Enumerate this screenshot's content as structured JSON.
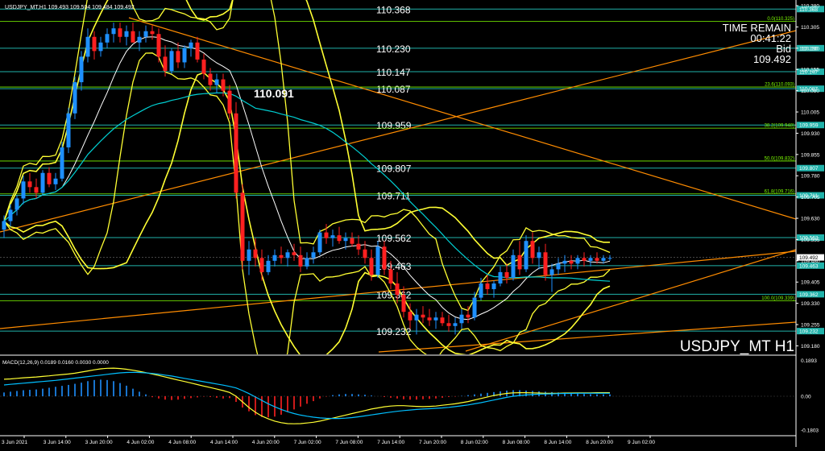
{
  "chart_data": {
    "type": "candlestick",
    "symbol_header": "USDJPY_MT,H1  109.493 109.504 109.484 109.492",
    "watermark": "USDJPY_MT H1",
    "info": {
      "time_remain_label": "TIME REMAIN",
      "time_remain": "00:41:22",
      "bid_label": "Bid",
      "bid": "109.492"
    },
    "price_axis": {
      "ylim": [
        109.15,
        110.4
      ],
      "ticks": [
        "110.380",
        "110.305",
        "110.230",
        "110.155",
        "110.080",
        "110.005",
        "109.930",
        "109.855",
        "109.780",
        "109.705",
        "109.630",
        "109.555",
        "109.480",
        "109.405",
        "109.330",
        "109.255",
        "109.180"
      ]
    },
    "levels": [
      {
        "value": 110.368,
        "label": "110.368",
        "tag": "110.368"
      },
      {
        "value": 110.23,
        "label": "110.230",
        "tag": "110.230"
      },
      {
        "value": 110.147,
        "label": "110.147",
        "tag": "110.147"
      },
      {
        "value": 110.087,
        "label": "110.087",
        "tag": "110.087"
      },
      {
        "value": 109.959,
        "label": "109.959",
        "tag": "109.959"
      },
      {
        "value": 109.807,
        "label": "109.807",
        "tag": "109.807"
      },
      {
        "value": 109.711,
        "label": "109.711",
        "tag": "109.711"
      },
      {
        "value": 109.562,
        "label": "109.562",
        "tag": "109.562"
      },
      {
        "value": 109.463,
        "label": "109.463",
        "tag": "109.463"
      },
      {
        "value": 109.362,
        "label": "109.362",
        "tag": "109.362"
      },
      {
        "value": 109.232,
        "label": "109.232",
        "tag": "109.232"
      }
    ],
    "fib_levels": [
      {
        "value": 110.325,
        "label": "0.0(110.325)"
      },
      {
        "value": 110.093,
        "label": "23.6(110.093)"
      },
      {
        "value": 109.948,
        "label": "38.2(109.948)"
      },
      {
        "value": 109.832,
        "label": "50.0(109.832)"
      },
      {
        "value": 109.716,
        "label": "61.8(109.716)"
      },
      {
        "value": 109.339,
        "label": "100.0(109.339)"
      }
    ],
    "annotation": {
      "text": "110.091",
      "value": 110.091
    },
    "current_price": {
      "value": 109.492,
      "tag": "109.492"
    },
    "x_labels": [
      "3 Jun 2021",
      "3 Jun 14:00",
      "3 Jun 20:00",
      "4 Jun 02:00",
      "4 Jun 08:00",
      "4 Jun 14:00",
      "4 Jun 20:00",
      "7 Jun 02:00",
      "7 Jun 08:00",
      "7 Jun 14:00",
      "7 Jun 20:00",
      "8 Jun 02:00",
      "8 Jun 08:00",
      "8 Jun 14:00",
      "8 Jun 20:00",
      "9 Jun 02:00"
    ],
    "candles": [
      [
        109.59,
        109.64,
        109.56,
        109.62
      ],
      [
        109.62,
        109.68,
        109.6,
        109.66
      ],
      [
        109.66,
        109.71,
        109.64,
        109.7
      ],
      [
        109.7,
        109.78,
        109.68,
        109.76
      ],
      [
        109.76,
        109.79,
        109.72,
        109.74
      ],
      [
        109.74,
        109.77,
        109.7,
        109.72
      ],
      [
        109.72,
        109.8,
        109.71,
        109.79
      ],
      [
        109.79,
        109.81,
        109.74,
        109.75
      ],
      [
        109.75,
        109.79,
        109.73,
        109.77
      ],
      [
        109.77,
        109.9,
        109.76,
        109.88
      ],
      [
        109.88,
        110.02,
        109.86,
        110.0
      ],
      [
        110.0,
        110.13,
        109.98,
        110.11
      ],
      [
        110.11,
        110.22,
        110.08,
        110.2
      ],
      [
        110.2,
        110.3,
        110.18,
        110.27
      ],
      [
        110.27,
        110.29,
        110.19,
        110.22
      ],
      [
        110.22,
        110.27,
        110.2,
        110.25
      ],
      [
        110.25,
        110.3,
        110.23,
        110.28
      ],
      [
        110.28,
        110.32,
        110.25,
        110.3
      ],
      [
        110.3,
        110.32,
        110.25,
        110.27
      ],
      [
        110.27,
        110.31,
        110.24,
        110.29
      ],
      [
        110.29,
        110.32,
        110.26,
        110.25
      ],
      [
        110.25,
        110.29,
        110.22,
        110.27
      ],
      [
        110.27,
        110.31,
        110.25,
        110.29
      ],
      [
        110.29,
        110.31,
        110.26,
        110.28
      ],
      [
        110.28,
        110.3,
        110.18,
        110.2
      ],
      [
        110.2,
        110.24,
        110.13,
        110.15
      ],
      [
        110.15,
        110.23,
        110.14,
        110.22
      ],
      [
        110.22,
        110.25,
        110.16,
        110.18
      ],
      [
        110.18,
        110.24,
        110.16,
        110.23
      ],
      [
        110.23,
        110.26,
        110.2,
        110.25
      ],
      [
        110.25,
        110.27,
        110.18,
        110.19
      ],
      [
        110.19,
        110.21,
        110.12,
        110.14
      ],
      [
        110.14,
        110.16,
        110.08,
        110.1
      ],
      [
        110.1,
        110.14,
        110.07,
        110.12
      ],
      [
        110.12,
        110.14,
        110.06,
        110.08
      ],
      [
        110.08,
        110.1,
        109.98,
        110.0
      ],
      [
        110.0,
        110.04,
        109.7,
        109.72
      ],
      [
        109.72,
        109.75,
        109.45,
        109.48
      ],
      [
        109.48,
        109.55,
        109.43,
        109.52
      ],
      [
        109.52,
        109.56,
        109.46,
        109.49
      ],
      [
        109.49,
        109.52,
        109.41,
        109.44
      ],
      [
        109.44,
        109.5,
        109.43,
        109.48
      ],
      [
        109.48,
        109.52,
        109.46,
        109.5
      ],
      [
        109.5,
        109.53,
        109.47,
        109.49
      ],
      [
        109.49,
        109.52,
        109.46,
        109.51
      ],
      [
        109.51,
        109.54,
        109.48,
        109.5
      ],
      [
        109.5,
        109.53,
        109.44,
        109.46
      ],
      [
        109.46,
        109.51,
        109.45,
        109.49
      ],
      [
        109.49,
        109.53,
        109.47,
        109.51
      ],
      [
        109.51,
        109.59,
        109.5,
        109.58
      ],
      [
        109.58,
        109.61,
        109.54,
        109.56
      ],
      [
        109.56,
        109.59,
        109.53,
        109.57
      ],
      [
        109.57,
        109.6,
        109.54,
        109.55
      ],
      [
        109.55,
        109.58,
        109.52,
        109.56
      ],
      [
        109.56,
        109.58,
        109.53,
        109.54
      ],
      [
        109.54,
        109.57,
        109.5,
        109.52
      ],
      [
        109.52,
        109.55,
        109.47,
        109.49
      ],
      [
        109.49,
        109.52,
        109.41,
        109.43
      ],
      [
        109.43,
        109.55,
        109.42,
        109.53
      ],
      [
        109.53,
        109.55,
        109.43,
        109.45
      ],
      [
        109.45,
        109.48,
        109.38,
        109.4
      ],
      [
        109.4,
        109.44,
        109.33,
        109.36
      ],
      [
        109.36,
        109.39,
        109.28,
        109.3
      ],
      [
        109.3,
        109.33,
        109.24,
        109.27
      ],
      [
        109.27,
        109.31,
        109.22,
        109.29
      ],
      [
        109.29,
        109.32,
        109.26,
        109.28
      ],
      [
        109.28,
        109.31,
        109.25,
        109.27
      ],
      [
        109.27,
        109.3,
        109.24,
        109.28
      ],
      [
        109.28,
        109.3,
        109.25,
        109.26
      ],
      [
        109.26,
        109.29,
        109.23,
        109.25
      ],
      [
        109.25,
        109.28,
        109.22,
        109.26
      ],
      [
        109.26,
        109.31,
        109.24,
        109.29
      ],
      [
        109.29,
        109.32,
        109.26,
        109.28
      ],
      [
        109.28,
        109.37,
        109.27,
        109.35
      ],
      [
        109.35,
        109.42,
        109.34,
        109.4
      ],
      [
        109.4,
        109.43,
        109.36,
        109.38
      ],
      [
        109.38,
        109.41,
        109.35,
        109.4
      ],
      [
        109.4,
        109.46,
        109.39,
        109.44
      ],
      [
        109.44,
        109.47,
        109.4,
        109.42
      ],
      [
        109.42,
        109.52,
        109.41,
        109.5
      ],
      [
        109.5,
        109.55,
        109.43,
        109.45
      ],
      [
        109.45,
        109.57,
        109.44,
        109.55
      ],
      [
        109.55,
        109.58,
        109.47,
        109.49
      ],
      [
        109.49,
        109.53,
        109.45,
        109.51
      ],
      [
        109.51,
        109.54,
        109.41,
        109.43
      ],
      [
        109.43,
        109.47,
        109.37,
        109.45
      ],
      [
        109.45,
        109.49,
        109.43,
        109.47
      ],
      [
        109.47,
        109.5,
        109.44,
        109.48
      ],
      [
        109.48,
        109.5,
        109.45,
        109.47
      ],
      [
        109.47,
        109.5,
        109.45,
        109.49
      ],
      [
        109.49,
        109.51,
        109.46,
        109.48
      ],
      [
        109.48,
        109.5,
        109.46,
        109.49
      ],
      [
        109.49,
        109.51,
        109.47,
        109.48
      ],
      [
        109.48,
        109.5,
        109.47,
        109.49
      ],
      [
        109.49,
        109.5,
        109.48,
        109.49
      ]
    ],
    "macd": {
      "label": "MACD(12,26,9) 0.0189 0.0160 0.0030 0.0000",
      "ticks": [
        "0.1893",
        "0.00",
        "-0.1803"
      ],
      "ylim": [
        -0.205,
        0.205
      ],
      "histogram": [
        0.02,
        0.024,
        0.028,
        0.032,
        0.034,
        0.036,
        0.04,
        0.045,
        0.05,
        0.055,
        0.06,
        0.066,
        0.072,
        0.08,
        0.086,
        0.088,
        0.086,
        0.08,
        0.07,
        0.056,
        0.04,
        0.024,
        0.01,
        -0.005,
        -0.012,
        -0.018,
        -0.02,
        -0.018,
        -0.014,
        -0.01,
        -0.006,
        -0.002,
        -0.004,
        -0.008,
        -0.012,
        -0.01,
        -0.03,
        -0.06,
        -0.08,
        -0.1,
        -0.11,
        -0.112,
        -0.108,
        -0.098,
        -0.084,
        -0.07,
        -0.055,
        -0.04,
        -0.026,
        -0.012,
        -0.002,
        0.006,
        0.01,
        0.012,
        0.012,
        0.01,
        0.008,
        0.004,
        0.0,
        -0.004,
        -0.008,
        -0.012,
        -0.016,
        -0.018,
        -0.018,
        -0.016,
        -0.014,
        -0.012,
        -0.008,
        -0.004,
        -0.002,
        0.002,
        0.006,
        0.01,
        0.014,
        0.018,
        0.022,
        0.026,
        0.03,
        0.032,
        0.032,
        0.03,
        0.028,
        0.026,
        0.024,
        0.022,
        0.02,
        0.018,
        0.016,
        0.014,
        0.012,
        0.011,
        0.01,
        0.01,
        0.01
      ],
      "macd_line": [
        0.09,
        0.092,
        0.095,
        0.098,
        0.1,
        0.102,
        0.105,
        0.108,
        0.112,
        0.115,
        0.118,
        0.122,
        0.128,
        0.134,
        0.14,
        0.145,
        0.148,
        0.149,
        0.147,
        0.143,
        0.138,
        0.132,
        0.125,
        0.118,
        0.11,
        0.102,
        0.094,
        0.086,
        0.078,
        0.07,
        0.062,
        0.054,
        0.046,
        0.038,
        0.03,
        0.02,
        0.0,
        -0.03,
        -0.06,
        -0.085,
        -0.105,
        -0.12,
        -0.132,
        -0.14,
        -0.145,
        -0.146,
        -0.145,
        -0.142,
        -0.138,
        -0.132,
        -0.124,
        -0.116,
        -0.108,
        -0.1,
        -0.092,
        -0.084,
        -0.076,
        -0.068,
        -0.062,
        -0.056,
        -0.052,
        -0.05,
        -0.05,
        -0.052,
        -0.054,
        -0.055,
        -0.054,
        -0.052,
        -0.048,
        -0.044,
        -0.04,
        -0.034,
        -0.028,
        -0.02,
        -0.012,
        -0.004,
        0.004,
        0.01,
        0.015,
        0.018,
        0.019,
        0.019,
        0.018,
        0.017,
        0.016,
        0.016,
        0.016,
        0.017,
        0.017,
        0.018,
        0.018,
        0.018,
        0.019,
        0.019,
        0.019
      ],
      "signal_line": [
        0.06,
        0.063,
        0.066,
        0.069,
        0.072,
        0.075,
        0.078,
        0.081,
        0.084,
        0.088,
        0.092,
        0.096,
        0.1,
        0.104,
        0.108,
        0.112,
        0.116,
        0.12,
        0.124,
        0.126,
        0.127,
        0.126,
        0.124,
        0.121,
        0.117,
        0.112,
        0.107,
        0.101,
        0.095,
        0.089,
        0.083,
        0.077,
        0.071,
        0.065,
        0.059,
        0.052,
        0.044,
        0.03,
        0.014,
        -0.004,
        -0.022,
        -0.04,
        -0.056,
        -0.07,
        -0.082,
        -0.092,
        -0.1,
        -0.106,
        -0.111,
        -0.115,
        -0.117,
        -0.118,
        -0.118,
        -0.116,
        -0.113,
        -0.109,
        -0.104,
        -0.099,
        -0.094,
        -0.089,
        -0.084,
        -0.08,
        -0.076,
        -0.073,
        -0.07,
        -0.068,
        -0.066,
        -0.064,
        -0.062,
        -0.059,
        -0.055,
        -0.051,
        -0.046,
        -0.04,
        -0.034,
        -0.027,
        -0.02,
        -0.013,
        -0.006,
        0.0,
        0.004,
        0.007,
        0.009,
        0.011,
        0.012,
        0.013,
        0.014,
        0.015,
        0.015,
        0.016,
        0.016,
        0.016,
        0.016,
        0.016,
        0.016
      ]
    },
    "colors": {
      "background": "#000000",
      "bull": "#1e90ff",
      "bear": "#ff2020",
      "level_line": "#20b2aa",
      "fib": "#7cfc00",
      "trend": "#ff8c00",
      "bands": "#ffff33",
      "ma_white": "#ffffff",
      "ma_cyan": "#00ced1",
      "macd_line": "#ffff33",
      "signal_line": "#00bfff",
      "hist_pos": "#1e90ff",
      "hist_neg": "#ff2020",
      "axis_text": "#ffffff"
    }
  }
}
